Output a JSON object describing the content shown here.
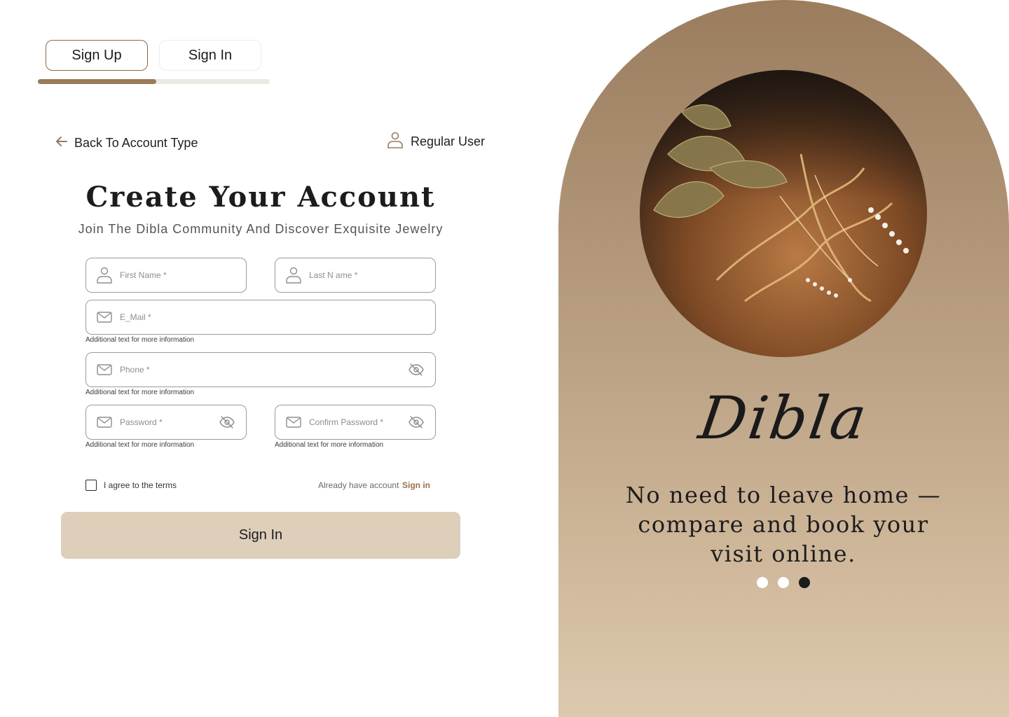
{
  "tabs": [
    {
      "label": "Sign Up",
      "active": true
    },
    {
      "label": "Sign In",
      "active": false
    }
  ],
  "progress": 0.51,
  "back_link": "Back To Account Type",
  "user_type": "Regular User",
  "title": "Create Your Account",
  "subtitle": "Join The Dibla Community And Discover Exquisite Jewelry",
  "form": {
    "first_name_placeholder": "First Name *",
    "last_name_placeholder": "Last N ame *",
    "email_placeholder": "E_Mail *",
    "phone_placeholder": "Phone *",
    "password_placeholder": "Password *",
    "confirm_password_placeholder": "Confirm Password *",
    "hint": "Additional text for more information",
    "terms_label": "I agree to the terms",
    "already_label": "Already have account",
    "signin_link": "Sign in",
    "submit_label": "Sign In"
  },
  "brand": "Dibla",
  "tagline": "No need to leave home — compare and book your visit online.",
  "carousel": {
    "count": 3,
    "active_index": 2
  },
  "colors": {
    "accent": "#9a7b5b",
    "button_bg": "#decfba",
    "panel_top": "#9b7d5e",
    "panel_bottom": "#ddc9ae"
  }
}
